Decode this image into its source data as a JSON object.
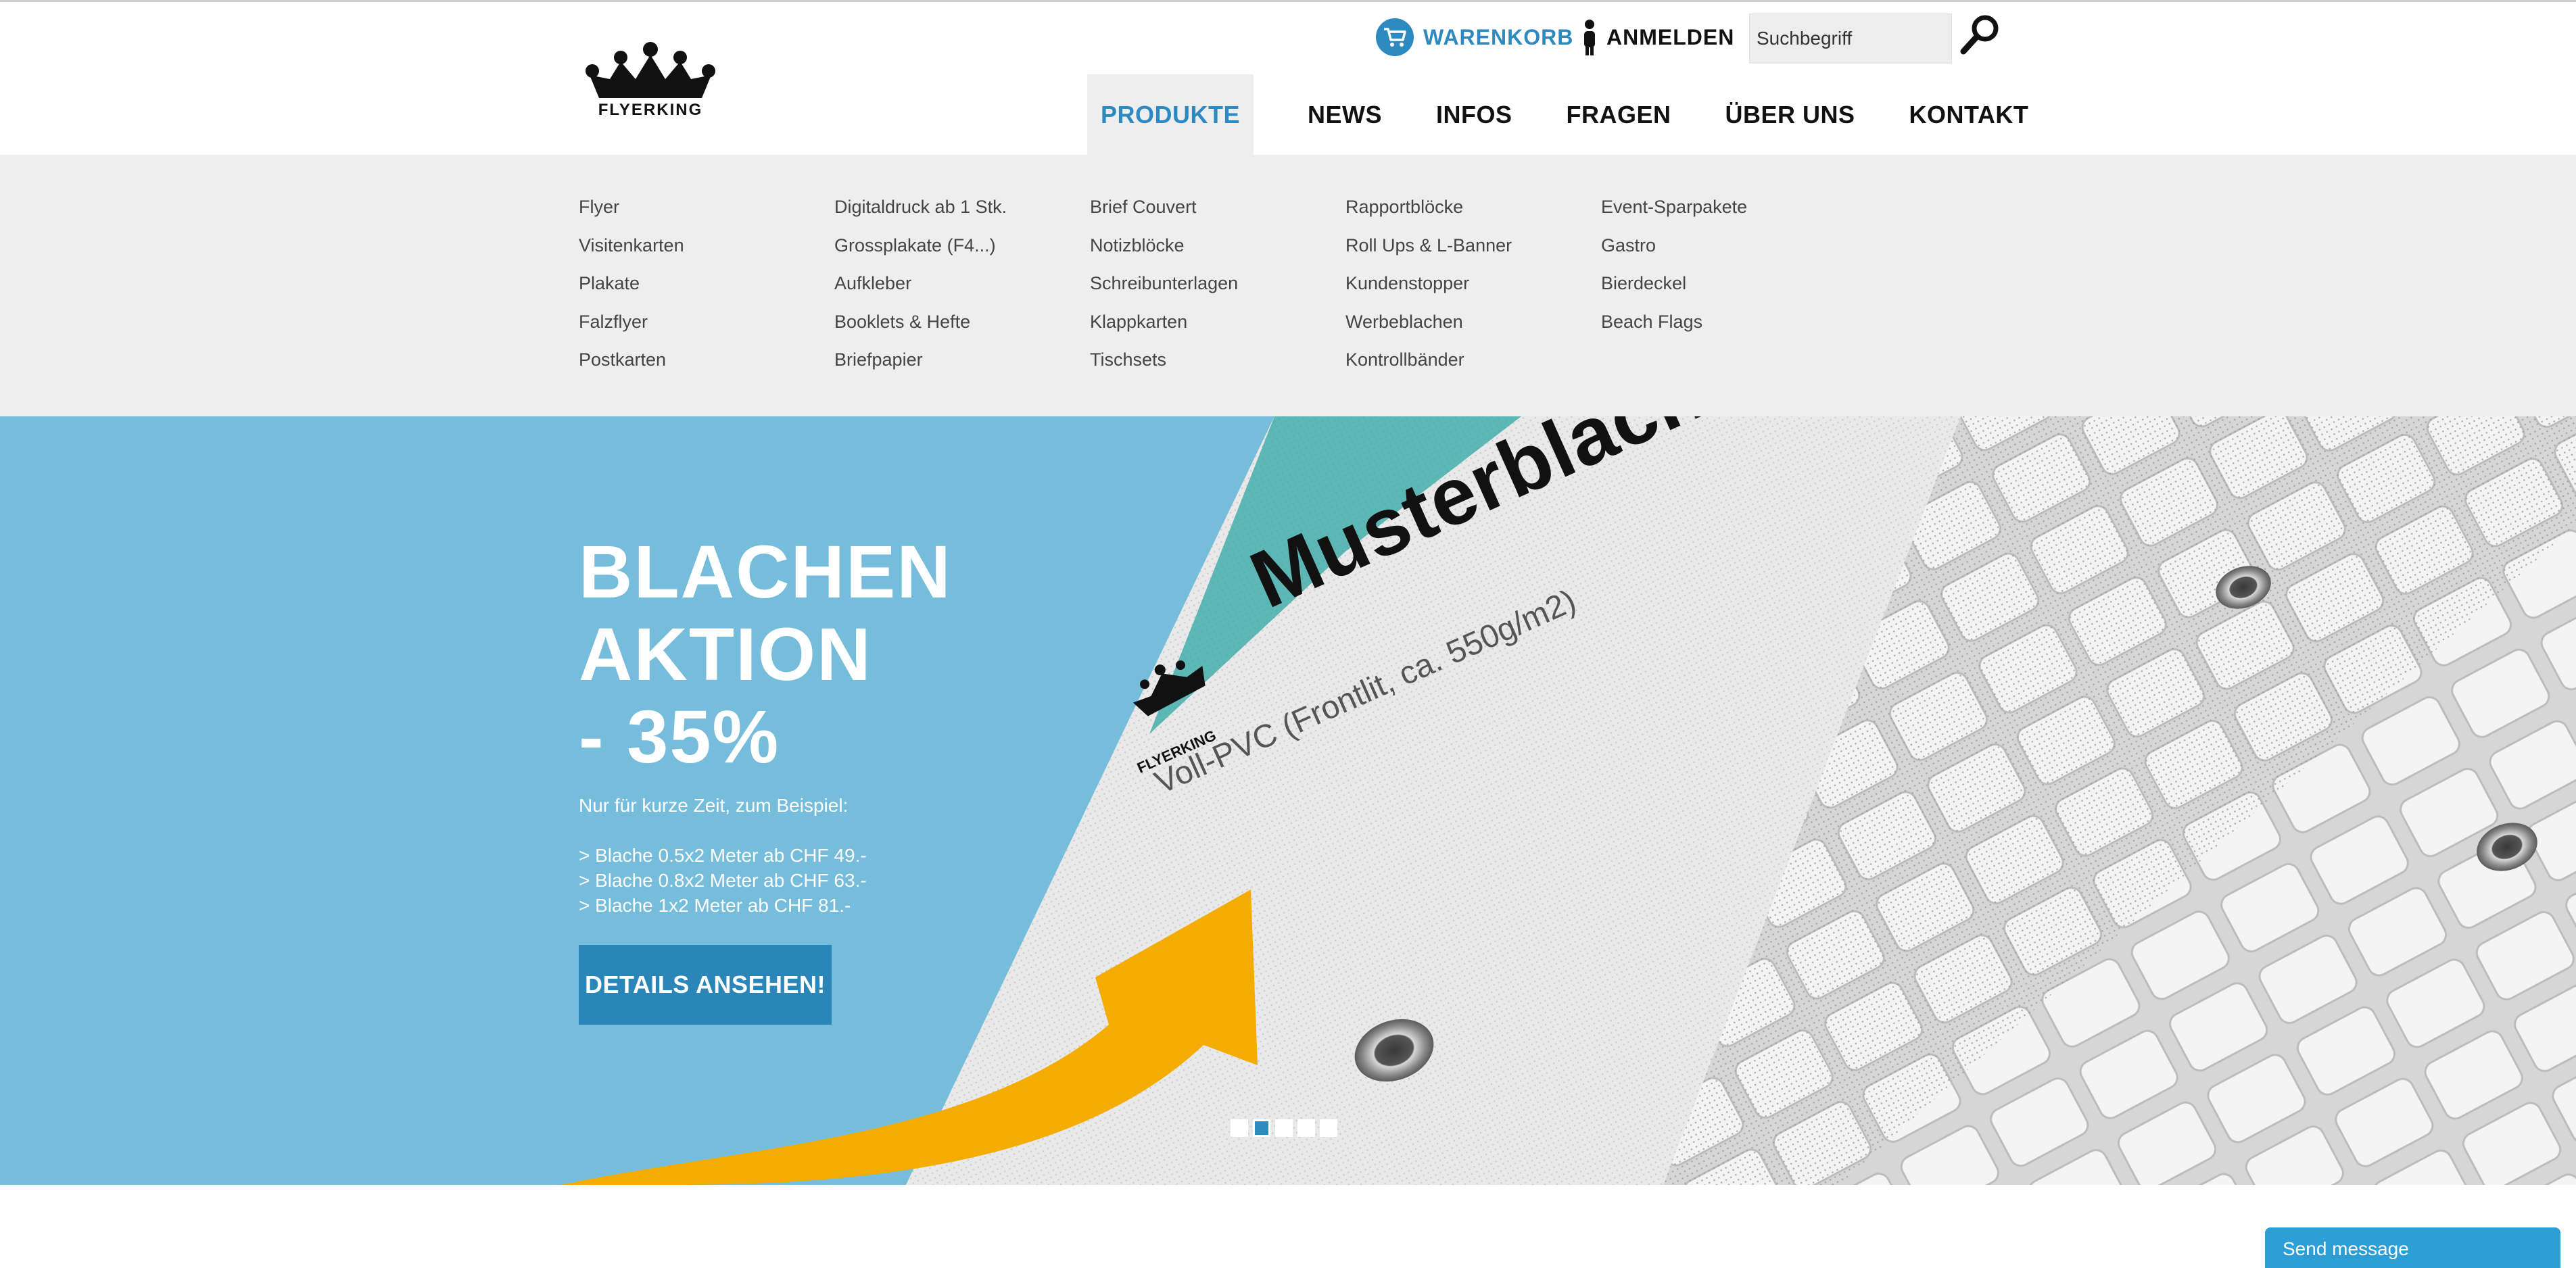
{
  "header": {
    "logo_text": "FLYERKING",
    "cart_label": "WARENKORB",
    "login_label": "ANMELDEN",
    "search_placeholder": "Suchbegriff",
    "nav": [
      {
        "label": "PRODUKTE",
        "active": true
      },
      {
        "label": "NEWS"
      },
      {
        "label": "INFOS"
      },
      {
        "label": "FRAGEN"
      },
      {
        "label": "ÜBER UNS"
      },
      {
        "label": "KONTAKT"
      }
    ]
  },
  "mega_menu": {
    "columns": [
      [
        "Flyer",
        "Visitenkarten",
        "Plakate",
        "Falzflyer",
        "Postkarten"
      ],
      [
        "Digitaldruck ab 1 Stk.",
        "Grossplakate (F4...)",
        "Aufkleber",
        "Booklets & Hefte",
        "Briefpapier"
      ],
      [
        "Brief Couvert",
        "Notizblöcke",
        "Schreibunterlagen",
        "Klappkarten",
        "Tischsets"
      ],
      [
        "Rapportblöcke",
        "Roll Ups & L-Banner",
        "Kundenstopper",
        "Werbeblachen",
        "Kontrollbänder"
      ],
      [
        "Event-Sparpakete",
        "Gastro",
        "Bierdeckel",
        "Beach Flags"
      ]
    ]
  },
  "hero": {
    "title_lines": [
      "BLACHEN",
      "AKTION",
      "- 35%"
    ],
    "subtitle": "Nur für kurze Zeit, zum Beispiel:",
    "examples": [
      "> Blache 0.5x2 Meter ab CHF 49.-",
      "> Blache 0.8x2 Meter ab CHF 63.-",
      "> Blache 1x2 Meter ab CHF 81.-"
    ],
    "button_label": "DETAILS ANSEHEN!",
    "banner_text": "Musterblache",
    "banner_subtext": "Voll-PVC (Frontlit, ca. 550g/m2)",
    "banner_logo": "FLYERKING",
    "slides": 5,
    "active_slide": 2
  },
  "chat": {
    "label": "Send message"
  },
  "colors": {
    "accent": "#2d8ac0",
    "hero_bg": "#76bcdb",
    "menu_bg": "#eeeeee",
    "arrow": "#f5ac00"
  }
}
